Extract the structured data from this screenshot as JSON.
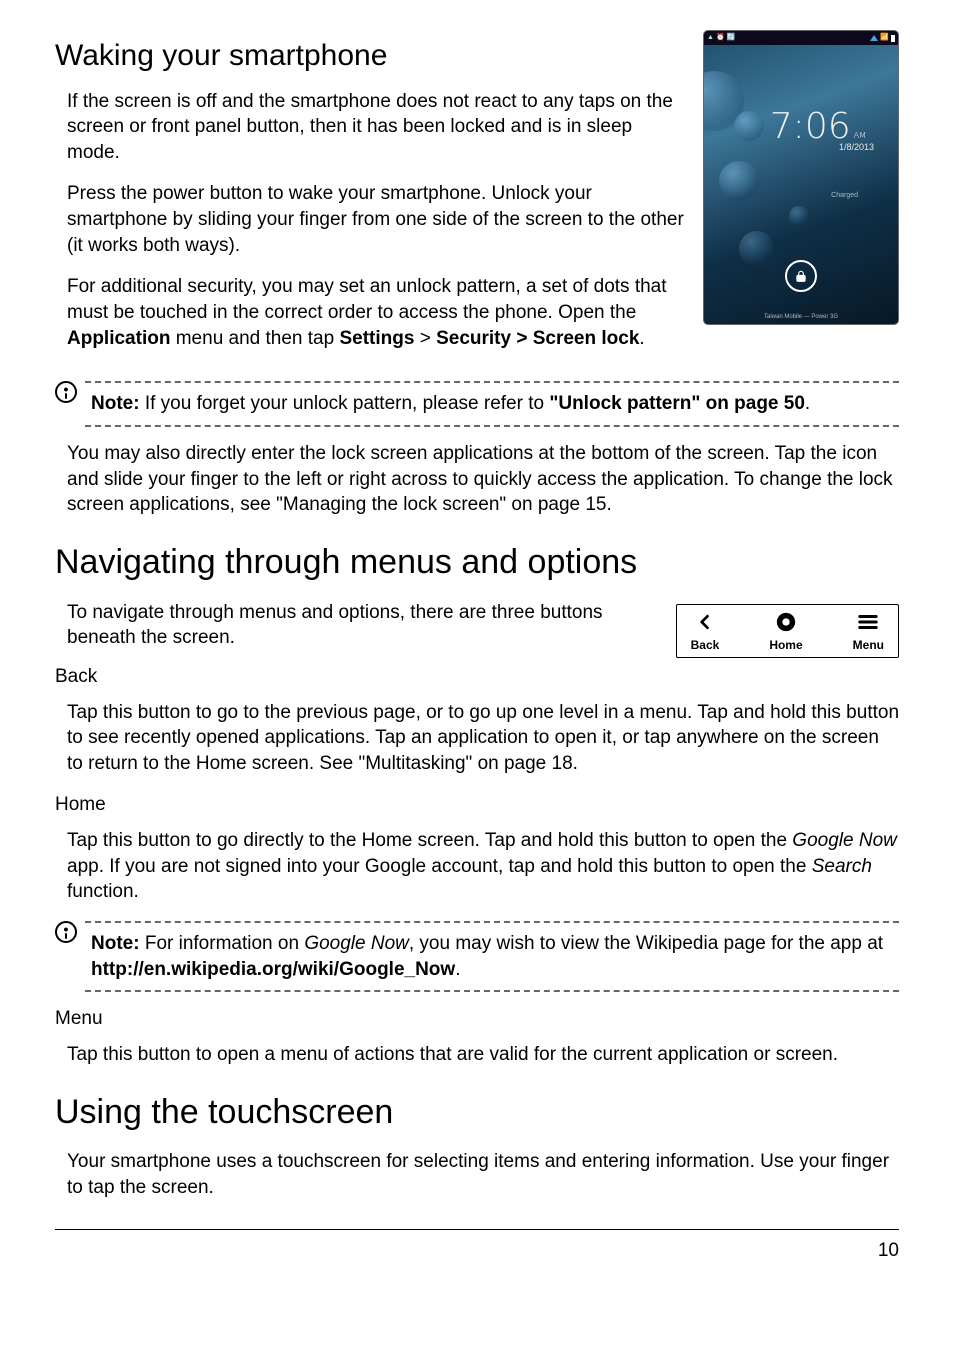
{
  "section1": {
    "title": "Waking your smartphone",
    "p1": "If the screen is off and the smartphone does not react to any taps on the screen or front panel button, then it has been locked and is in sleep mode.",
    "p2": "Press the power button to wake your smartphone. Unlock your smartphone by sliding your finger from one side of the screen to the other (it works both ways).",
    "p3_a": "For additional security, you may set an unlock pattern, a set of dots that must be touched in the correct order to access the phone. Open the ",
    "p3_app": "Application",
    "p3_b": " menu and then tap ",
    "p3_settings": "Settings",
    "p3_gt": " > ",
    "p3_security": "Security > Screen lock",
    "p3_period": ".",
    "note1_label": "Note:",
    "note1_a": " If you forget your unlock pattern, please refer to ",
    "note1_link": "\"Unlock pattern\" on page 50",
    "note1_period": ".",
    "p4": "You may also directly enter the lock screen applications at the bottom of the screen. Tap the icon and slide your finger to the left or right across to quickly access the application. To change the lock screen applications, see \"Managing the lock screen\" on page 15."
  },
  "phone": {
    "time": "7:06",
    "ampm": "AM",
    "date": "1/8/2013",
    "charged": "Charged",
    "carrier": "Taiwan Mobile — Power 3G"
  },
  "section2": {
    "title": "Navigating through menus and options",
    "intro": "To navigate through menus and options, there are three buttons beneath the screen.",
    "back_label": "Back",
    "home_label": "Home",
    "menu_label": "Menu",
    "back_head": "Back",
    "back_text": "Tap this button to go to the previous page, or to go up one level in a menu.  Tap and hold this button to see recently opened applications. Tap an application to open it, or tap anywhere on the screen to return to the Home screen. See \"Multitasking\" on page 18.",
    "home_head": "Home",
    "home_a": "Tap this button to go directly to the Home screen. Tap and hold this button to open the ",
    "home_gn": "Google Now",
    "home_b": " app. If you are not signed into your Google account, tap and hold this button to open the ",
    "home_search": "Search",
    "home_c": " function.",
    "note2_label": "Note:",
    "note2_a": " For information on ",
    "note2_gn": "Google Now",
    "note2_b": ", you may wish to view the Wikipedia page for the app at ",
    "note2_url": "http://en.wikipedia.org/wiki/Google_Now",
    "note2_period": ".",
    "menu_head": "Menu",
    "menu_text": "Tap this button to open a menu of actions that are valid for the current application or screen."
  },
  "section3": {
    "title": "Using the touchscreen",
    "p1": "Your smartphone uses a touchscreen for selecting items and entering information. Use your finger to tap the screen."
  },
  "page_number": "10"
}
